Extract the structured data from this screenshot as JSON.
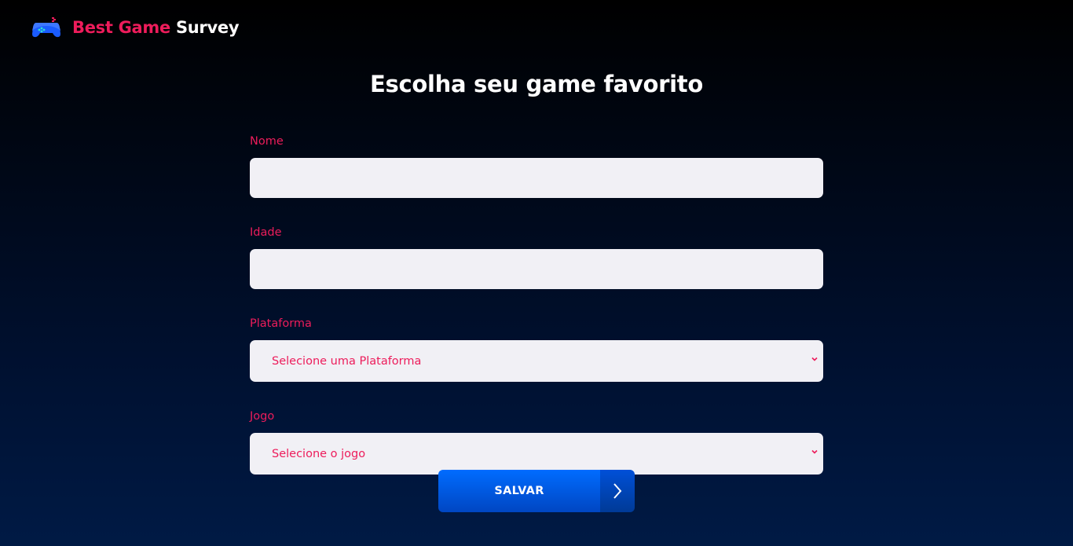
{
  "header": {
    "logo_icon": "gamepad-icon",
    "brand_accent": "Best Game",
    "brand_plain": "Survey"
  },
  "title": "Escolha seu game favorito",
  "form": {
    "name_label": "Nome",
    "name_value": "",
    "age_label": "Idade",
    "age_value": "",
    "platform_label": "Plataforma",
    "platform_selected": "Selecione uma Plataforma",
    "game_label": "Jogo",
    "game_selected": "Selecione o jogo",
    "submit_label": "SALVAR",
    "submit_icon": "chevron-right-icon"
  },
  "colors": {
    "accent": "#ed1c5b",
    "button": "#0058e6",
    "field_bg": "#f1f0f5"
  }
}
